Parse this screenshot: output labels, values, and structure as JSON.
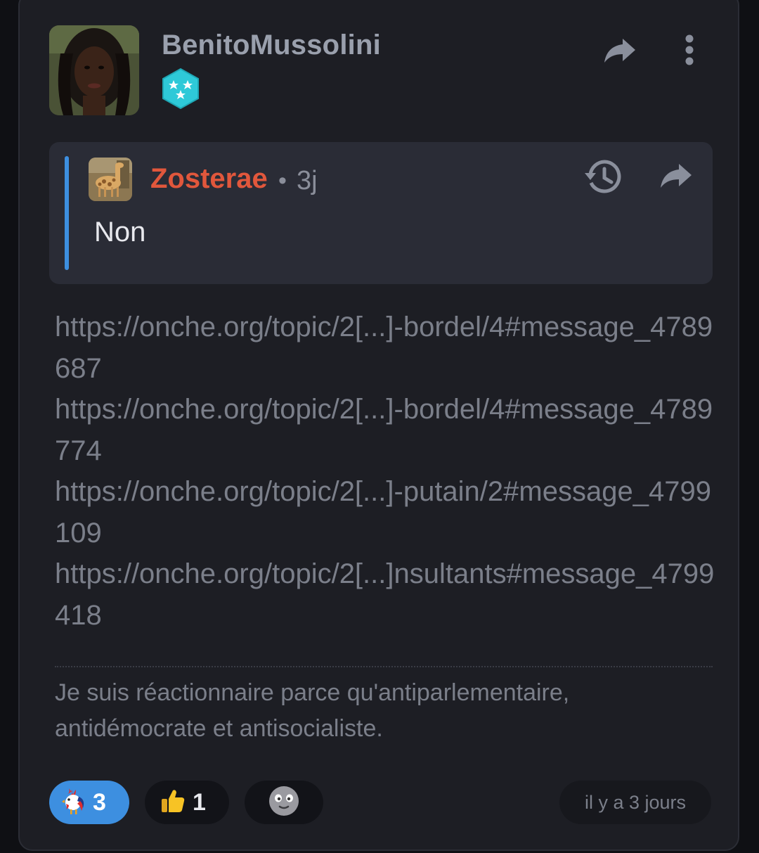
{
  "post": {
    "author": "BenitoMussolini",
    "avatar_icon": "user-avatar",
    "badge_icon": "hexagon-stars-badge",
    "badge_color": "#2ec9d8"
  },
  "quote": {
    "author": "Zosterae",
    "separator": "•",
    "time": "3j",
    "text": "Non",
    "avatar_icon": "giraffe-avatar",
    "accent": "#3d8fe0",
    "author_color": "#e1573c"
  },
  "body": {
    "links": [
      "https://onche.org/topic/2[...]-bordel/4#message_4789687",
      "https://onche.org/topic/2[...]-bordel/4#message_4789774",
      "https://onche.org/topic/2[...]-putain/2#message_4799109",
      "https://onche.org/topic/2[...]nsultants#message_4799418"
    ]
  },
  "signature": "Je suis réactionnaire parce qu'antiparlementaire, antidémocrate et antisocialiste.",
  "reactions": [
    {
      "icon": "rooster-emoji",
      "count": "3",
      "active": true
    },
    {
      "icon": "thumbs-up-emoji",
      "count": "1",
      "active": false
    },
    {
      "icon": "add-reaction-emoji",
      "count": "",
      "active": false
    }
  ],
  "timestamp": "il y a 3 jours"
}
